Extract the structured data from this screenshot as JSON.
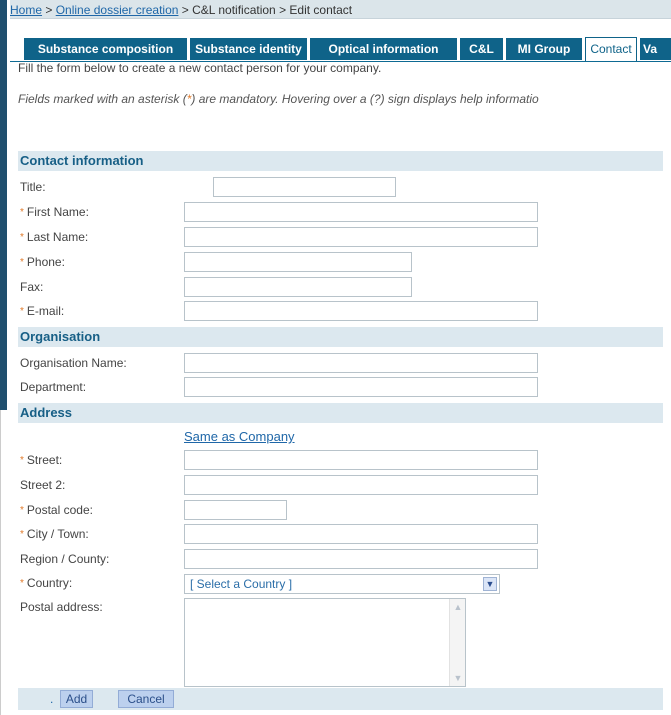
{
  "breadcrumb": {
    "home": "Home",
    "sep1": " > ",
    "dossier": "Online dossier creation",
    "sep2": " > ",
    "notification": "C&L notification",
    "sep3": " > ",
    "current": "Edit contact"
  },
  "tabs": [
    {
      "label": "Substance composition"
    },
    {
      "label": "Substance identity"
    },
    {
      "label": "Optical information"
    },
    {
      "label": "C&L"
    },
    {
      "label": "MI Group"
    },
    {
      "label": "Contact",
      "active": true
    },
    {
      "label": "Va"
    }
  ],
  "intro": "Fill the form below to create a new contact person for your company.",
  "note": {
    "before": "Fields marked with an asterisk (",
    "asterisk": "*",
    "after": ") are mandatory. Hovering over a (?) sign displays help informatio"
  },
  "sections": {
    "contact": "Contact information",
    "organisation": "Organisation",
    "address": "Address"
  },
  "required_marker": "*",
  "fields": {
    "title": {
      "label": "Title:",
      "value": ""
    },
    "first_name": {
      "label": "First Name:",
      "value": ""
    },
    "last_name": {
      "label": "Last Name:",
      "value": ""
    },
    "phone": {
      "label": "Phone:",
      "value": ""
    },
    "fax": {
      "label": "Fax:",
      "value": ""
    },
    "email": {
      "label": "E-mail:",
      "value": ""
    },
    "org_name": {
      "label": "Organisation Name:",
      "value": ""
    },
    "department": {
      "label": "Department:",
      "value": ""
    },
    "street": {
      "label": "Street:",
      "value": ""
    },
    "street2": {
      "label": "Street 2:",
      "value": ""
    },
    "postal_code": {
      "label": "Postal code:",
      "value": ""
    },
    "city": {
      "label": "City / Town:",
      "value": ""
    },
    "region": {
      "label": "Region / County:",
      "value": ""
    },
    "country": {
      "label": "Country:",
      "value": "[ Select a Country ]"
    },
    "postal_address": {
      "label": "Postal address:",
      "value": ""
    }
  },
  "same_as_company": "Same as Company",
  "footer": {
    "dot": ".",
    "add": "Add",
    "cancel": "Cancel"
  },
  "colors": {
    "tab_bg": "#0f6389",
    "section_bg": "#dce8ef",
    "section_text": "#175f86",
    "required": "#e07a2a",
    "link": "#1f67a8"
  }
}
